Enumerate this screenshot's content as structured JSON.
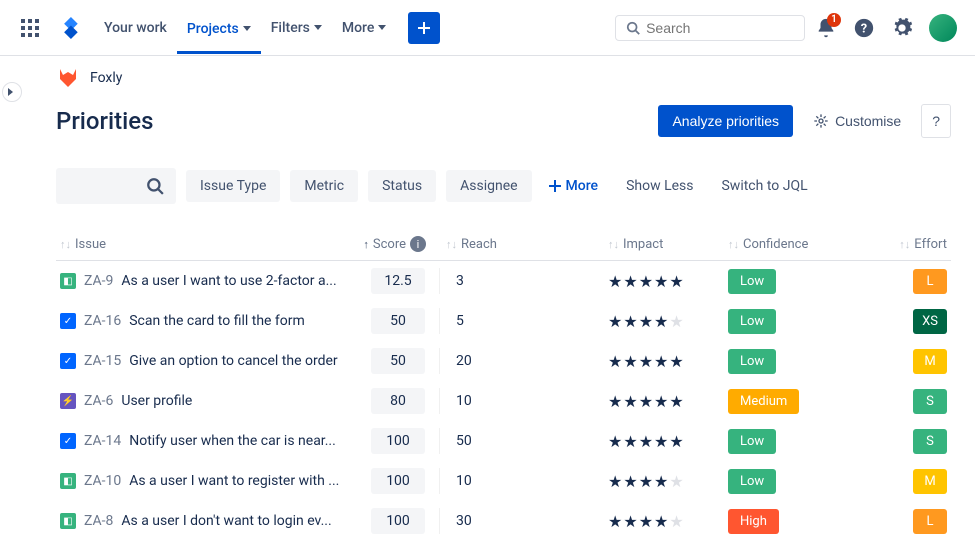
{
  "topnav": {
    "items": [
      "Your work",
      "Projects",
      "Filters",
      "More"
    ],
    "active_index": 1,
    "search_placeholder": "Search",
    "notif_count": "1"
  },
  "project": {
    "name": "Foxly"
  },
  "page": {
    "title": "Priorities",
    "actions": {
      "analyze": "Analyze priorities",
      "customise": "Customise",
      "help": "?"
    }
  },
  "filters": {
    "chips": [
      "Issue Type",
      "Metric",
      "Status",
      "Assignee"
    ],
    "more": "More",
    "show_less": "Show Less",
    "switch_jql": "Switch to JQL"
  },
  "columns": {
    "issue": "Issue",
    "score": "Score",
    "reach": "Reach",
    "impact": "Impact",
    "confidence": "Confidence",
    "effort": "Effort"
  },
  "rows": [
    {
      "type": "story",
      "key": "ZA-9",
      "summary": "As a user I want to use 2-factor a...",
      "score": "12.5",
      "reach": "3",
      "impact": 5,
      "confidence": "Low",
      "effort": "L"
    },
    {
      "type": "task",
      "key": "ZA-16",
      "summary": "Scan the card to fill the form",
      "score": "50",
      "reach": "5",
      "impact": 4,
      "confidence": "Low",
      "effort": "XS"
    },
    {
      "type": "task",
      "key": "ZA-15",
      "summary": "Give an option to cancel the order",
      "score": "50",
      "reach": "20",
      "impact": 5,
      "confidence": "Low",
      "effort": "M"
    },
    {
      "type": "epic",
      "key": "ZA-6",
      "summary": "User profile",
      "score": "80",
      "reach": "10",
      "impact": 5,
      "confidence": "Medium",
      "effort": "S"
    },
    {
      "type": "task",
      "key": "ZA-14",
      "summary": "Notify user when the car is near...",
      "score": "100",
      "reach": "50",
      "impact": 5,
      "confidence": "Low",
      "effort": "S"
    },
    {
      "type": "story",
      "key": "ZA-10",
      "summary": "As a user I want to register with ...",
      "score": "100",
      "reach": "10",
      "impact": 4,
      "confidence": "Low",
      "effort": "M"
    },
    {
      "type": "story",
      "key": "ZA-8",
      "summary": "As a user I don't want to login ev...",
      "score": "100",
      "reach": "30",
      "impact": 4,
      "confidence": "High",
      "effort": "L"
    }
  ],
  "issue_type_colors": {
    "story": "#36b37e",
    "task": "#0065ff",
    "epic": "#6554c0"
  }
}
